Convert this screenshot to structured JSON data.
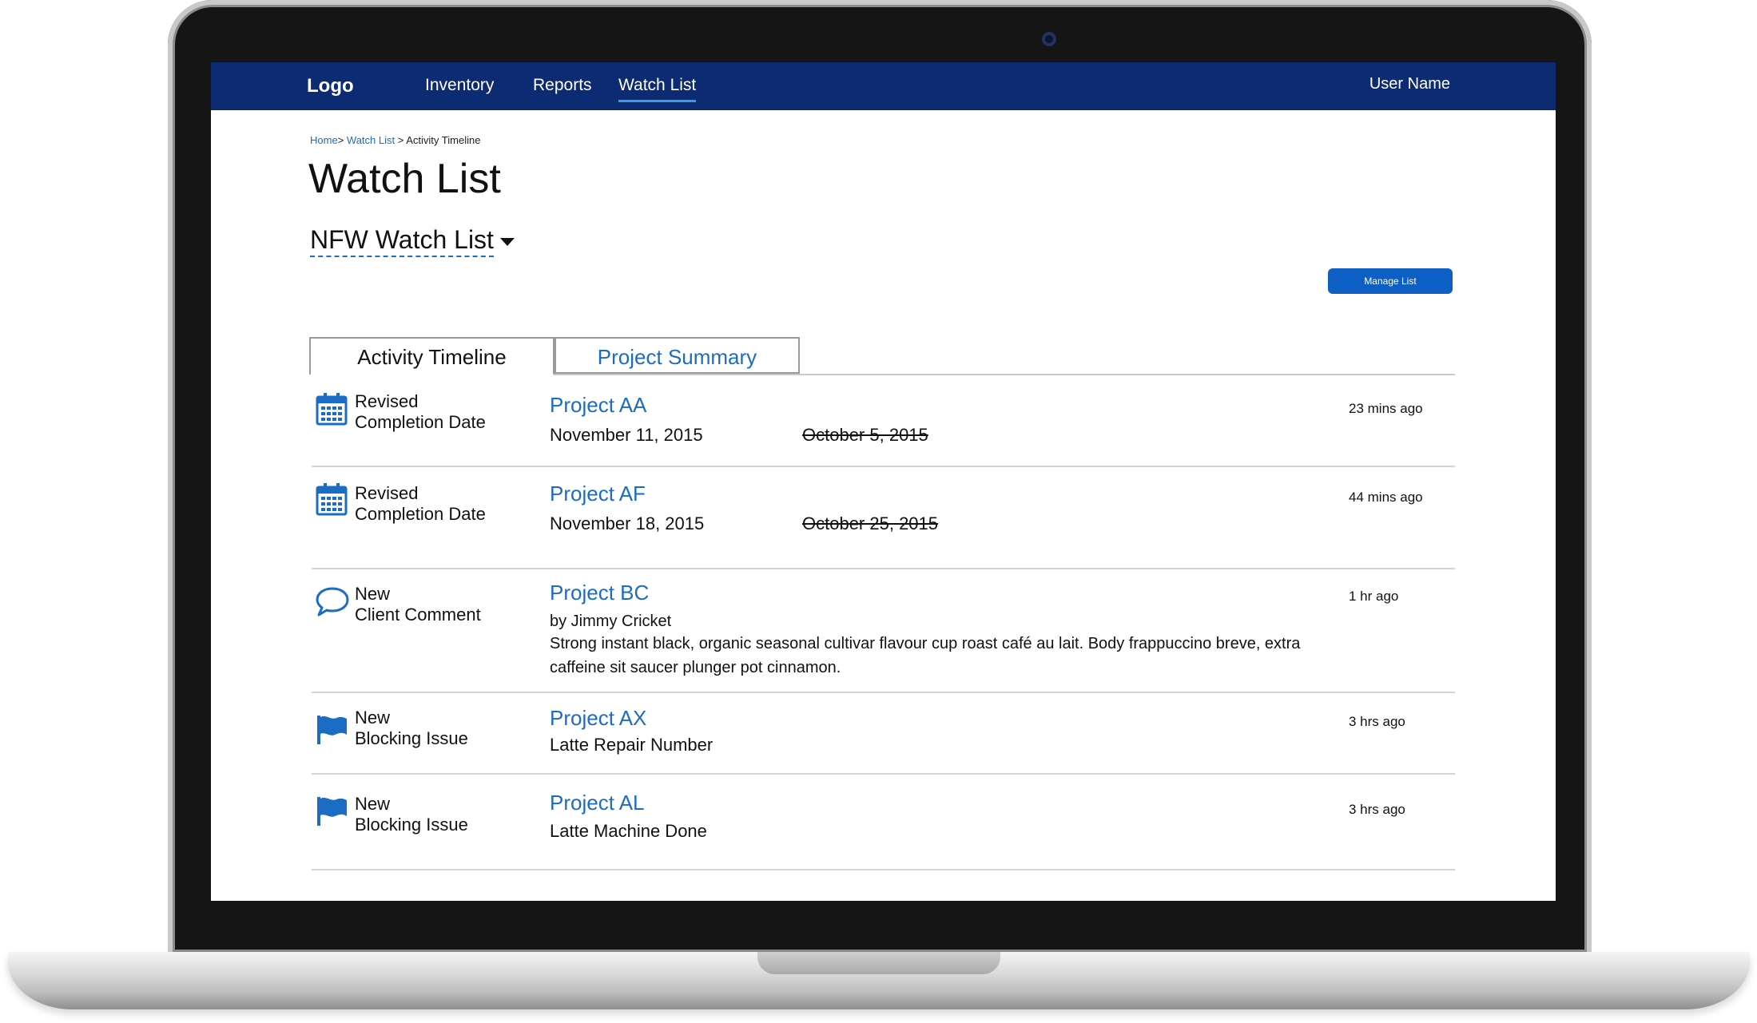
{
  "nav": {
    "logo": "Logo",
    "links": [
      "Inventory",
      "Reports",
      "Watch List"
    ],
    "user": "User Name"
  },
  "breadcrumb": {
    "home": "Home",
    "sep1": ">",
    "watch_list": "Watch List",
    "sep2": ">",
    "current": "Activity Timeline"
  },
  "page": {
    "title": "Watch List",
    "selected_list": "NFW Watch List",
    "manage_button": "Manage List"
  },
  "tabs": [
    "Activity Timeline",
    "Project Summary"
  ],
  "activity": [
    {
      "icon": "calendar-icon",
      "type_line1": "Revised",
      "type_line2": "Completion Date",
      "project": "Project AA",
      "new_date": "November 11, 2015",
      "old_date": "October 5, 2015",
      "time": "23 mins ago"
    },
    {
      "icon": "calendar-icon",
      "type_line1": "Revised",
      "type_line2": "Completion Date",
      "project": "Project AF",
      "new_date": "November 18, 2015",
      "old_date": "October 25, 2015",
      "time": "44 mins ago"
    },
    {
      "icon": "comment-icon",
      "type_line1": "New",
      "type_line2": "Client Comment",
      "project": "Project BC",
      "author": "by Jimmy Cricket",
      "comment": "Strong instant black, organic seasonal cultivar flavour cup roast café au lait. Body frappuccino breve, extra caffeine sit saucer plunger pot cinnamon.",
      "time": "1 hr ago"
    },
    {
      "icon": "flag-icon",
      "type_line1": "New",
      "type_line2": "Blocking Issue",
      "project": "Project AX",
      "detail": "Latte Repair Number",
      "time": "3 hrs ago"
    },
    {
      "icon": "flag-icon",
      "type_line1": "New",
      "type_line2": "Blocking Issue",
      "project": "Project AL",
      "detail": "Latte Machine Done",
      "time": "3 hrs ago"
    }
  ],
  "colors": {
    "nav_bg": "#0d2b72",
    "link": "#1b6cc4",
    "button": "#0d5fc4",
    "active_underline": "#3f9ae6"
  }
}
